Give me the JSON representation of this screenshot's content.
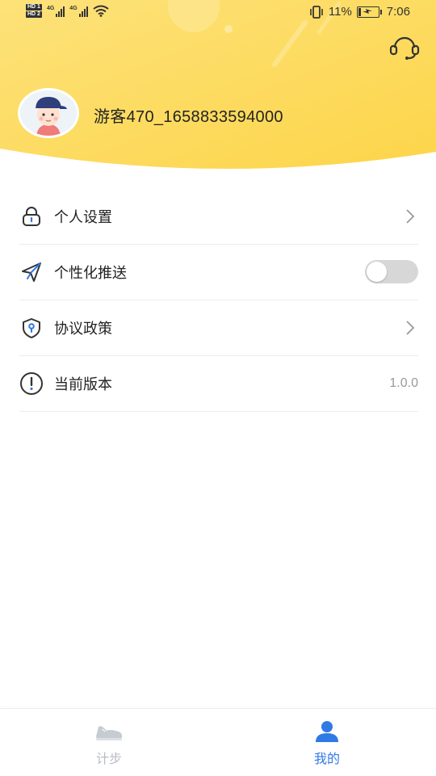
{
  "status_bar": {
    "hd1": "HD 1",
    "hd2": "HD 2",
    "net1": "4G",
    "net2": "4G",
    "battery_percent": "11%",
    "battery_level": 0.11,
    "time": "7:06"
  },
  "header": {
    "support_icon": "headset-icon",
    "username": "游客470_1658833594000",
    "accent_color": "#fdd94f"
  },
  "menu": {
    "items": [
      {
        "label": "个人设置",
        "icon": "lock-icon",
        "trailing": "chevron"
      },
      {
        "label": "个性化推送",
        "icon": "send-icon",
        "trailing": "toggle",
        "toggle_on": false
      },
      {
        "label": "协议政策",
        "icon": "shield-icon",
        "trailing": "chevron"
      },
      {
        "label": "当前版本",
        "icon": "info-icon",
        "trailing": "text",
        "value": "1.0.0"
      }
    ]
  },
  "bottom_nav": {
    "items": [
      {
        "label": "计步",
        "icon": "shoe-icon",
        "active": false
      },
      {
        "label": "我的",
        "icon": "user-icon",
        "active": true
      }
    ],
    "active_color": "#2f7ae5",
    "inactive_color": "#b8bcc4"
  }
}
